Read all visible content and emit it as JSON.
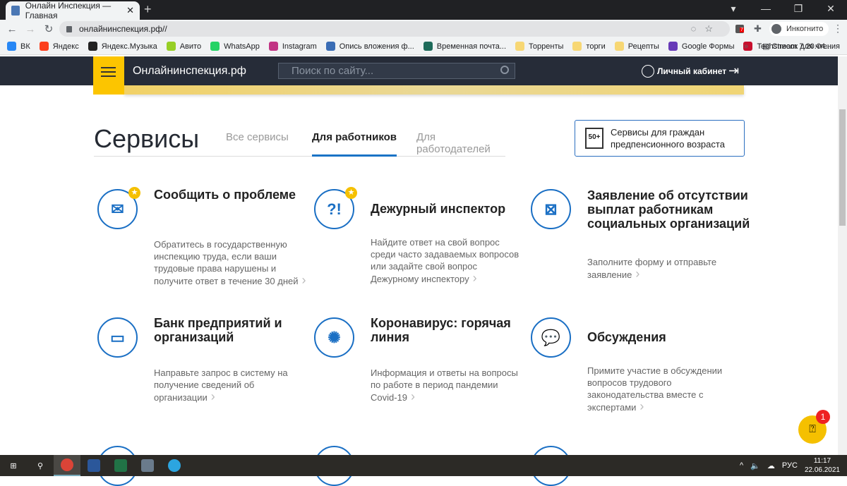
{
  "browser": {
    "tab_title": "Онлайн Инспекция — Главная",
    "url": "онлайнинспекция.рф//",
    "incognito": "Инкогнито",
    "extension_badge": "7",
    "bookmarks": [
      {
        "label": "ВК",
        "color": "#2787f5"
      },
      {
        "label": "Яндекс",
        "color": "#fc3f1d"
      },
      {
        "label": "Яндекс.Музыка",
        "color": "#222"
      },
      {
        "label": "Авито",
        "color": "#97cf26"
      },
      {
        "label": "WhatsApp",
        "color": "#25d366"
      },
      {
        "label": "Instagram",
        "color": "#c13584"
      },
      {
        "label": "Опись вложения ф...",
        "color": "#3a6db5"
      },
      {
        "label": "Временная почта...",
        "color": "#1e6b5a"
      },
      {
        "label": "Торренты",
        "color": "#f7d774"
      },
      {
        "label": "торги",
        "color": "#f7d774"
      },
      {
        "label": "Рецепты",
        "color": "#f7d774"
      },
      {
        "label": "Google Формы",
        "color": "#673ab7"
      },
      {
        "label": "Techstream 7.20.04...",
        "color": "#c8102e"
      }
    ],
    "more": "»",
    "reading_list": "Список для чтения"
  },
  "header": {
    "logo": "Онлайнинспекция.рф",
    "search_placeholder": "Поиск по сайту...",
    "cabinet": "Личный кабинет"
  },
  "services": {
    "title": "Сервисы",
    "tabs": [
      {
        "label": "Все сервисы"
      },
      {
        "label": "Для работников",
        "active": true
      },
      {
        "label": "Для работодателей"
      }
    ],
    "pension_badge": "50+",
    "pension_button": "Сервисы для граждан предпенсионного возраста",
    "cards": [
      {
        "icon": "envelope-icon",
        "glyph": "✉",
        "starred": true,
        "title": "Сообщить о проблеме",
        "desc": "Обратитесь в государственную инспекцию труда, если ваши трудовые права нарушены и получите ответ в течение 30 дней"
      },
      {
        "icon": "question-exclamation-icon",
        "glyph": "?!",
        "starred": true,
        "title": "Дежурный инспектор",
        "desc": "Найдите ответ на свой вопрос среди часто задаваемых вопросов или задайте свой вопрос Дежурному инспектору"
      },
      {
        "icon": "wallet-icon",
        "glyph": "⊠",
        "starred": false,
        "title": "Заявление об отсутствии выплат работникам социальных организаций",
        "desc": "Заполните форму и отправьте заявление"
      },
      {
        "icon": "folder-icon",
        "glyph": "▭",
        "starred": false,
        "title": "Банк предприятий и организаций",
        "desc": "Направьте запрос в систему на получение сведений об организации"
      },
      {
        "icon": "virus-icon",
        "glyph": "✺",
        "starred": false,
        "title": "Коронавирус: горячая линия",
        "desc": "Информация и ответы на вопросы по работе в период пандемии Covid-19"
      },
      {
        "icon": "chat-bubbles-icon",
        "glyph": "💬",
        "starred": false,
        "title": "Обсуждения",
        "desc": "Примите участие в обсуждении вопросов трудового законодательства вместе с экспертами"
      }
    ]
  },
  "chat_widget": {
    "badge": "1"
  },
  "taskbar": {
    "lang": "РУС",
    "time": "11:17",
    "date": "22.06.2021"
  }
}
